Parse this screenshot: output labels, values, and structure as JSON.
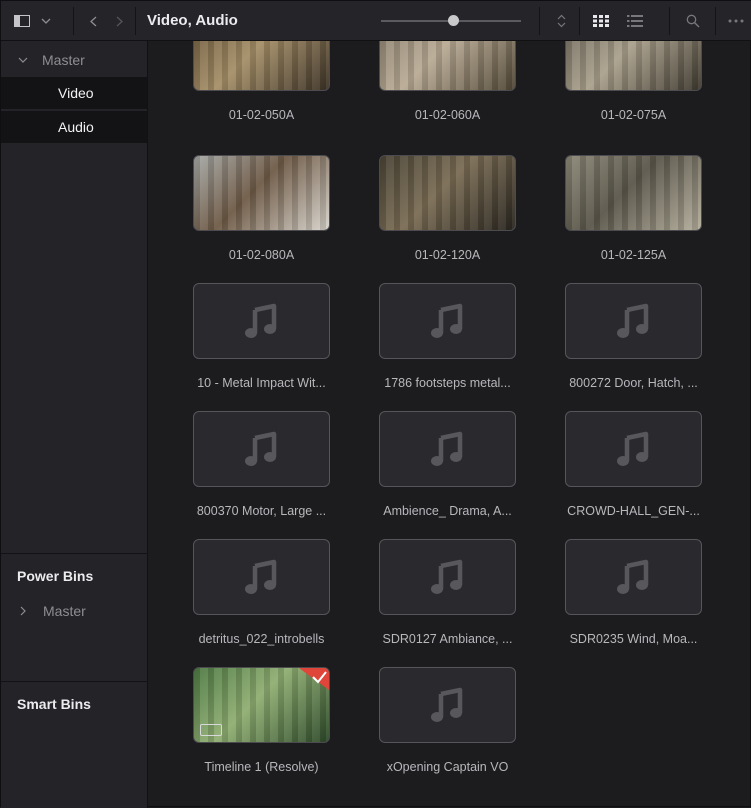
{
  "toolbar": {
    "title": "Video, Audio",
    "icons": [
      "panel-toggle-icon",
      "chevron-down-icon",
      "back-icon",
      "forward-icon",
      "sort-icon",
      "grid-view-icon",
      "list-view-icon",
      "search-icon",
      "more-options-icon"
    ],
    "zoom_slider_value": 0.5
  },
  "sidebar": {
    "master_label": "Master",
    "items": [
      {
        "label": "Video",
        "selected": true
      },
      {
        "label": "Audio",
        "selected": true
      }
    ],
    "power_bins_header": "Power Bins",
    "power_master_label": "Master",
    "smart_bins_header": "Smart Bins"
  },
  "clips": [
    {
      "label": "01-02-050A",
      "type": "video",
      "colors": [
        "#6d5a3e",
        "#a58f68",
        "#3d3327"
      ]
    },
    {
      "label": "01-02-060A",
      "type": "video",
      "colors": [
        "#8a7e6e",
        "#b9ab95",
        "#514736"
      ]
    },
    {
      "label": "01-02-075A",
      "type": "video",
      "colors": [
        "#6f6a5e",
        "#aaa08c",
        "#3f3a30"
      ]
    },
    {
      "label": "01-02-080A",
      "type": "video",
      "colors": [
        "#a7a9a6",
        "#6e5a46",
        "#d8d4cc"
      ]
    },
    {
      "label": "01-02-120A",
      "type": "video",
      "colors": [
        "#4a4436",
        "#7a6c54",
        "#2a2620"
      ]
    },
    {
      "label": "01-02-125A",
      "type": "video",
      "colors": [
        "#8c8878",
        "#5a564a",
        "#b4ae9c"
      ]
    },
    {
      "label": "10 - Metal Impact Wit...",
      "type": "audio"
    },
    {
      "label": "1786 footsteps metal...",
      "type": "audio"
    },
    {
      "label": "800272 Door, Hatch, ...",
      "type": "audio"
    },
    {
      "label": "800370 Motor, Large ...",
      "type": "audio"
    },
    {
      "label": "Ambience_ Drama, A...",
      "type": "audio"
    },
    {
      "label": "CROWD-HALL_GEN-...",
      "type": "audio"
    },
    {
      "label": "detritus_022_introbells",
      "type": "audio"
    },
    {
      "label": "SDR0127 Ambiance, ...",
      "type": "audio"
    },
    {
      "label": "SDR0235 Wind, Moa...",
      "type": "audio"
    },
    {
      "label": "Timeline 1 (Resolve)",
      "type": "timeline",
      "colors": [
        "#4f7a44",
        "#8fae72",
        "#2e4a2a"
      ],
      "accent": "#e0453a"
    },
    {
      "label": "xOpening Captain VO",
      "type": "audio"
    }
  ]
}
